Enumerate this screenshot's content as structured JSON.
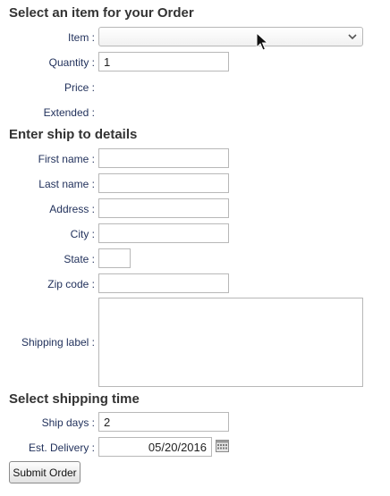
{
  "sections": {
    "order_heading": "Select an item for your Order",
    "ship_heading": "Enter ship to details",
    "time_heading": "Select shipping time"
  },
  "order": {
    "item_label": "Item :",
    "item_value": "",
    "quantity_label": "Quantity :",
    "quantity_value": "1",
    "price_label": "Price :",
    "extended_label": "Extended :"
  },
  "ship": {
    "first_name_label": "First name :",
    "last_name_label": "Last name :",
    "address_label": "Address :",
    "city_label": "City :",
    "state_label": "State :",
    "zip_label": "Zip code :",
    "shipping_label_label": "Shipping label :"
  },
  "timing": {
    "ship_days_label": "Ship days :",
    "ship_days_value": "2",
    "est_delivery_label": "Est. Delivery :",
    "est_delivery_value": "05/20/2016"
  },
  "submit_label": "Submit Order",
  "icons": {
    "dropdown": "chevron-down-icon",
    "calendar": "calendar-icon",
    "cursor": "mouse-pointer-icon"
  }
}
